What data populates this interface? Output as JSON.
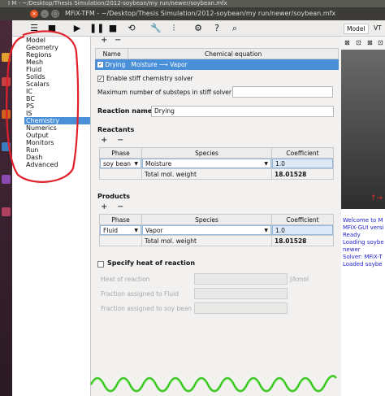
{
  "window": {
    "top_strip": "I M - ~/Desktop/Thesis Simulation/2012-soybean/my run/newer/soybean.mfx",
    "title": "MFiX-TFM - ~/Desktop/Thesis Simulation/2012-soybean/my run/newer/soybean.mfx"
  },
  "nav": {
    "items": [
      "Model",
      "Geometry",
      "Regions",
      "Mesh",
      "Fluid",
      "Solids",
      "Scalars",
      "IC",
      "BC",
      "PS",
      "IS",
      "Chemistry",
      "Numerics",
      "Output",
      "Monitors",
      "Run",
      "Dash",
      "Advanced"
    ],
    "selected": "Chemistry"
  },
  "reactions_table": {
    "headers": [
      "Name",
      "Chemical equation"
    ],
    "row": {
      "name": "Drying",
      "equation": "Moisture ⟶ Vapor"
    }
  },
  "stiff": {
    "enable_label": "Enable stiff chemistry solver",
    "max_substeps_label": "Maximum number of substeps in stiff solver",
    "max_substeps_value": ""
  },
  "reaction_name": {
    "label": "Reaction name",
    "value": "Drying"
  },
  "reactants": {
    "title": "Reactants",
    "headers": [
      "Phase",
      "Species",
      "Coefficient"
    ],
    "row": {
      "phase": "soy bean",
      "species": "Moisture",
      "coefficient": "1.0"
    },
    "total_label": "Total mol. weight",
    "total_value": "18.01528"
  },
  "products": {
    "title": "Products",
    "headers": [
      "Phase",
      "Species",
      "Coefficient"
    ],
    "row": {
      "phase": "Fluid",
      "species": "Vapor",
      "coefficient": "1.0"
    },
    "total_label": "Total mol. weight",
    "total_value": "18.01528"
  },
  "heat": {
    "title": "Specify heat of reaction",
    "heat_label": "Heat of reaction",
    "heat_unit": "J/kmol",
    "fluid_label": "Fraction assigned to Fluid",
    "soy_label": "Fraction assigned to soy bean"
  },
  "right_panel": {
    "tab_model": "Model",
    "tab_vtk": "VT",
    "log": [
      "Welcome to M",
      "MFiX-GUI versi",
      "Ready",
      "Loading soybe",
      "newer",
      "Solver: MFiX-T",
      "Loaded soybe"
    ]
  },
  "colors": {
    "accent": "#4a90d9",
    "annotation_red": "#e0202a",
    "annotation_green": "#3ccc22"
  }
}
